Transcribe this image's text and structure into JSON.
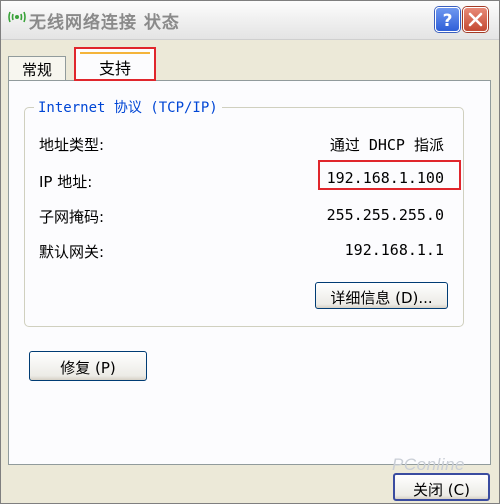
{
  "window": {
    "title": "无线网络连接 状态"
  },
  "title_buttons": {
    "help": "?",
    "close": "✕"
  },
  "tabs": [
    {
      "label": "常规",
      "selected": false
    },
    {
      "label": "支持",
      "selected": true
    }
  ],
  "group": {
    "legend": "Internet 协议 (TCP/IP)",
    "rows": [
      {
        "label": "地址类型:",
        "value": "通过 DHCP 指派"
      },
      {
        "label": "IP 地址:",
        "value": "192.168.1.100"
      },
      {
        "label": "子网掩码:",
        "value": "255.255.255.0"
      },
      {
        "label": "默认网关:",
        "value": "192.168.1.1"
      }
    ]
  },
  "buttons": {
    "details": "详细信息 (D)...",
    "repair": "修复 (P)",
    "close": "关闭 (C)"
  },
  "watermark": "PConline",
  "colors": {
    "highlight_red": "#e0262c",
    "legend_blue": "#0046d5",
    "panel_bg": "#fcfcfe",
    "window_bg": "#ece9d8"
  },
  "icons": {
    "title": "wireless-network-icon",
    "help": "help-icon",
    "close": "close-icon"
  }
}
